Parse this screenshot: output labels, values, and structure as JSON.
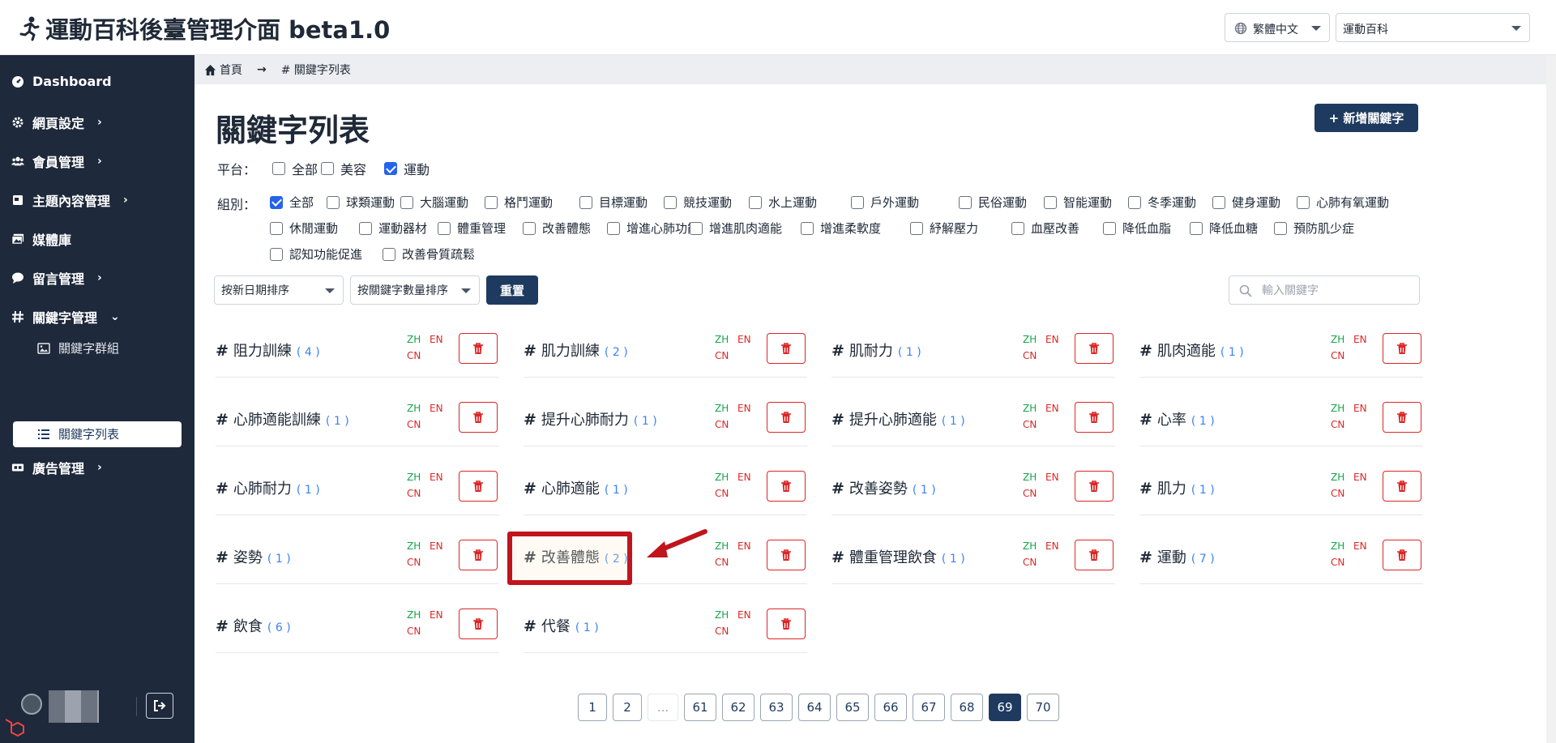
{
  "header": {
    "title": "運動百科後臺管理介面 beta1.0",
    "lang_select": "繁體中文",
    "site_select": "運動百科"
  },
  "sidebar": {
    "items": [
      {
        "label": "Dashboard",
        "icon": "dashboard-icon"
      },
      {
        "label": "網頁設定",
        "icon": "gear-icon",
        "chevron": "›"
      },
      {
        "label": "會員管理",
        "icon": "users-icon",
        "chevron": "›"
      },
      {
        "label": "主題內容管理",
        "icon": "book-icon",
        "chevron": "›"
      },
      {
        "label": "媒體庫",
        "icon": "images-icon"
      },
      {
        "label": "留言管理",
        "icon": "comment-icon",
        "chevron": "›"
      },
      {
        "label": "關鍵字管理",
        "icon": "hash-icon",
        "chevron": "⌄"
      },
      {
        "label": "廣告管理",
        "icon": "ad-icon",
        "chevron": "›"
      }
    ],
    "sub_items": [
      {
        "label": "關鍵字群組",
        "icon": "image-icon"
      },
      {
        "label": "關鍵字列表",
        "icon": "list-icon"
      }
    ]
  },
  "breadcrumb": {
    "home": "首頁",
    "arrow": "→",
    "current": "# 關鍵字列表"
  },
  "page": {
    "title": "關鍵字列表",
    "add_button": "+ 新增關鍵字",
    "platform_label": "平台：",
    "group_label": "組別：",
    "platforms": [
      {
        "label": "全部",
        "checked": false
      },
      {
        "label": "美容",
        "checked": false
      },
      {
        "label": "運動",
        "checked": true
      }
    ],
    "groups_row1": [
      {
        "label": "全部",
        "checked": true
      },
      {
        "label": "球類運動",
        "checked": false
      },
      {
        "label": "大腦運動",
        "checked": false
      },
      {
        "label": "格鬥運動",
        "checked": false
      },
      {
        "label": "目標運動",
        "checked": false
      },
      {
        "label": "競技運動",
        "checked": false
      },
      {
        "label": "水上運動",
        "checked": false
      },
      {
        "label": "戶外運動",
        "checked": false
      },
      {
        "label": "民俗運動",
        "checked": false
      },
      {
        "label": "智能運動",
        "checked": false
      },
      {
        "label": "冬季運動",
        "checked": false
      },
      {
        "label": "健身運動",
        "checked": false
      },
      {
        "label": "心肺有氧運動",
        "checked": false
      }
    ],
    "groups_row2": [
      {
        "label": "休閒運動",
        "checked": false
      },
      {
        "label": "運動器材",
        "checked": false
      },
      {
        "label": "體重管理",
        "checked": false
      },
      {
        "label": "改善體態",
        "checked": false
      },
      {
        "label": "增進心肺功能",
        "checked": false
      },
      {
        "label": "增進肌肉適能",
        "checked": false
      },
      {
        "label": "增進柔軟度",
        "checked": false
      },
      {
        "label": "紓解壓力",
        "checked": false
      },
      {
        "label": "血壓改善",
        "checked": false
      },
      {
        "label": "降低血脂",
        "checked": false
      },
      {
        "label": "降低血糖",
        "checked": false
      },
      {
        "label": "預防肌少症",
        "checked": false
      }
    ],
    "groups_row3": [
      {
        "label": "認知功能促進",
        "checked": false
      },
      {
        "label": "改善骨質疏鬆",
        "checked": false
      }
    ],
    "sort_date": "按新日期排序",
    "sort_count": "按關鍵字數量排序",
    "reset_button": "重置",
    "search_placeholder": "輸入關鍵字"
  },
  "keywords": [
    {
      "name": "阻力訓練",
      "count": "( 4 )"
    },
    {
      "name": "肌力訓練",
      "count": "( 2 )"
    },
    {
      "name": "肌耐力",
      "count": "( 1 )"
    },
    {
      "name": "肌肉適能",
      "count": "( 1 )"
    },
    {
      "name": "心肺適能訓練",
      "count": "( 1 )"
    },
    {
      "name": "提升心肺耐力",
      "count": "( 1 )"
    },
    {
      "name": "提升心肺適能",
      "count": "( 1 )"
    },
    {
      "name": "心率",
      "count": "( 1 )"
    },
    {
      "name": "心肺耐力",
      "count": "( 1 )"
    },
    {
      "name": "心肺適能",
      "count": "( 1 )"
    },
    {
      "name": "改善姿勢",
      "count": "( 1 )"
    },
    {
      "name": "肌力",
      "count": "( 1 )"
    },
    {
      "name": "姿勢",
      "count": "( 1 )"
    },
    {
      "name": "改善體態",
      "count": "( 2 )"
    },
    {
      "name": "體重管理飲食",
      "count": "( 1 )"
    },
    {
      "name": "運動",
      "count": "( 7 )"
    },
    {
      "name": "飲食",
      "count": "( 6 )"
    },
    {
      "name": "代餐",
      "count": "( 1 )"
    }
  ],
  "lang_tags": {
    "zh": "ZH",
    "en": "EN",
    "cn": "CN"
  },
  "hash_symbol": "#",
  "pagination": [
    "1",
    "2",
    "...",
    "61",
    "62",
    "63",
    "64",
    "65",
    "66",
    "67",
    "68",
    "69",
    "70"
  ],
  "current_page": "69",
  "colors": {
    "sidebar_bg": "#1e293b",
    "primary": "#1e3a5f",
    "danger": "#dc2626",
    "success": "#16a34a",
    "highlight": "#c0151e"
  }
}
